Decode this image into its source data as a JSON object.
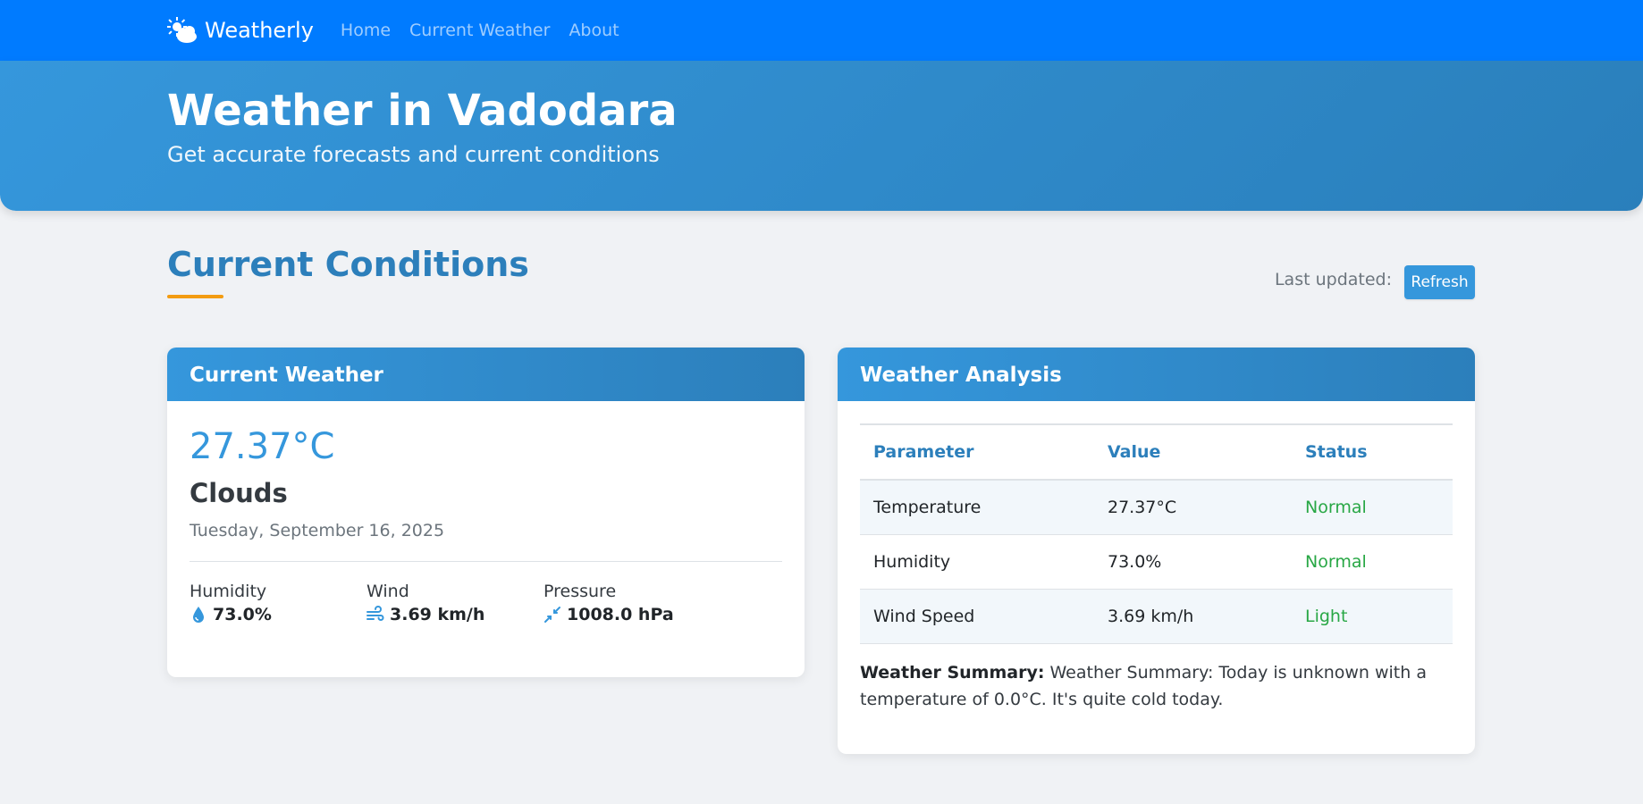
{
  "navbar": {
    "brand": "Weatherly",
    "brand_icon": "sun-cloud-icon",
    "links": [
      "Home",
      "Current Weather",
      "About"
    ]
  },
  "hero": {
    "title": "Weather in Vadodara",
    "subtitle": "Get accurate forecasts and current conditions"
  },
  "section": {
    "title": "Current Conditions",
    "last_updated_label": "Last updated:",
    "refresh_label": "Refresh"
  },
  "current_weather": {
    "title": "Current Weather",
    "temperature": "27.37°C",
    "condition": "Clouds",
    "date": "Tuesday, September 16, 2025",
    "stats": [
      {
        "label": "Humidity",
        "value": "73.0%",
        "icon": "droplet-icon"
      },
      {
        "label": "Wind",
        "value": "3.69 km/h",
        "icon": "wind-icon"
      },
      {
        "label": "Pressure",
        "value": "1008.0 hPa",
        "icon": "compress-arrows-icon"
      }
    ]
  },
  "analysis": {
    "title": "Weather Analysis",
    "headers": [
      "Parameter",
      "Value",
      "Status"
    ],
    "rows": [
      {
        "parameter": "Temperature",
        "value": "27.37°C",
        "status": "Normal"
      },
      {
        "parameter": "Humidity",
        "value": "73.0%",
        "status": "Normal"
      },
      {
        "parameter": "Wind Speed",
        "value": "3.69 km/h",
        "status": "Light"
      }
    ],
    "summary_label": "Weather Summary:",
    "summary_text": " Weather Summary: Today is unknown with a temperature of 0.0°C. It's quite cold today."
  },
  "colors": {
    "navbar": "#007bff",
    "primary": "#3597dc",
    "accent": "#f39c12",
    "status_good": "#28a745"
  }
}
